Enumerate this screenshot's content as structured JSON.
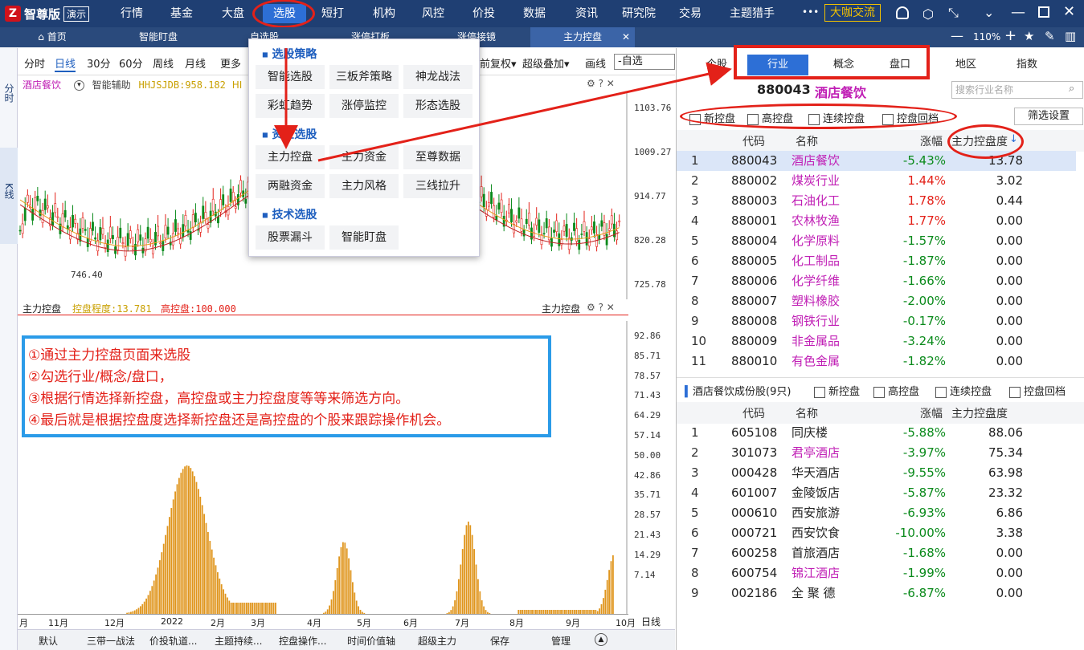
{
  "app": {
    "logo_name": "智尊版",
    "demo": "演示"
  },
  "menu": [
    "行情",
    "基金",
    "大盘",
    "选股",
    "短打",
    "机构",
    "风控",
    "价投",
    "数据",
    "资讯",
    "研究院",
    "交易",
    "主题猎手"
  ],
  "more_label": "•••",
  "exchange_button": "大咖交流",
  "tabs": [
    "首页",
    "智能盯盘",
    "自选股",
    "涨停打板",
    "涨停接镜",
    "主力控盘"
  ],
  "zoom": "110%",
  "left_strip": {
    "top": "分时",
    "bottom": "K线"
  },
  "chart_toolbar": [
    "分时",
    "日线",
    "30分",
    "60分",
    "周线",
    "月线",
    "更多"
  ],
  "chart_toolbar_right": {
    "fuquan": "前复权▾",
    "overlay": "超级叠加▾",
    "draw": "画线",
    "combo": "-自选"
  },
  "kline": {
    "name": "酒店餐饮",
    "assist": "智能辅助",
    "indicator": "HHJSJDB:958.182",
    "indicator_tail": "HI",
    "ticks": [
      "1103.76",
      "1009.27",
      "914.77",
      "820.28",
      "725.78"
    ],
    "low_label": "746.40"
  },
  "lower": {
    "title": "主力控盘",
    "degree": "控盘程度:13.781",
    "high": "高控盘:100.000",
    "right_label": "主力控盘",
    "ticks": [
      "92.86",
      "85.71",
      "78.57",
      "71.43",
      "64.29",
      "57.14",
      "50.00",
      "42.86",
      "35.71",
      "28.57",
      "21.43",
      "14.29",
      "7.14"
    ],
    "xlabels": [
      "月",
      "11月",
      "12月",
      "2022",
      "2月",
      "3月",
      "4月",
      "5月",
      "6月",
      "7月",
      "8月",
      "9月",
      "10月"
    ],
    "period": "日线"
  },
  "dropdown": {
    "sec1": "选股策略",
    "items1": [
      "智能选股",
      "三板斧策略",
      "神龙战法",
      "彩虹趋势",
      "涨停监控",
      "形态选股"
    ],
    "sec2": "资金选股",
    "items2": [
      "主力控盘",
      "主力资金",
      "至尊数据",
      "两融资金",
      "主力风格",
      "三线拉升"
    ],
    "sec3": "技术选股",
    "items3": [
      "股票漏斗",
      "智能盯盘"
    ]
  },
  "annotation": [
    "①通过主力控盘页面来选股",
    "②勾选行业/概念/盘口，",
    "③根据行情选择新控盘，高控盘或主力控盘度等等来筛选方向。",
    "④最后就是根据控盘度选择新控盘还是高控盘的个股来跟踪操作机会。"
  ],
  "bottom_tools": [
    "默认",
    "三带一战法",
    "价投轨道...",
    "主题持续...",
    "控盘操作...",
    "时间价值轴",
    "超级主力",
    "保存",
    "管理"
  ],
  "right": {
    "tabs": [
      "个股",
      "行业",
      "概念",
      "盘口",
      "地区",
      "指数"
    ],
    "code": "880043",
    "name": "酒店餐饮",
    "search_placeholder": "搜索行业名称",
    "filters": [
      "新控盘",
      "高控盘",
      "连续控盘",
      "控盘回档"
    ],
    "filter_btn": "筛选设置",
    "headers": [
      "代码",
      "名称",
      "涨幅",
      "主力控盘度"
    ],
    "rows": [
      [
        "1",
        "880043",
        "酒店餐饮",
        "-5.43%",
        "13.78"
      ],
      [
        "2",
        "880002",
        "煤炭行业",
        "1.44%",
        "3.02"
      ],
      [
        "3",
        "880003",
        "石油化工",
        "1.78%",
        "0.44"
      ],
      [
        "4",
        "880001",
        "农林牧渔",
        "1.77%",
        "0.00"
      ],
      [
        "5",
        "880004",
        "化学原料",
        "-1.57%",
        "0.00"
      ],
      [
        "6",
        "880005",
        "化工制品",
        "-1.87%",
        "0.00"
      ],
      [
        "7",
        "880006",
        "化学纤维",
        "-1.66%",
        "0.00"
      ],
      [
        "8",
        "880007",
        "塑料橡胶",
        "-2.00%",
        "0.00"
      ],
      [
        "9",
        "880008",
        "钢铁行业",
        "-0.17%",
        "0.00"
      ],
      [
        "10",
        "880009",
        "非金属品",
        "-3.24%",
        "0.00"
      ],
      [
        "11",
        "880010",
        "有色金属",
        "-1.82%",
        "0.00"
      ]
    ],
    "sub_title": "酒店餐饮成份股(9只)",
    "sub_rows": [
      [
        "1",
        "605108",
        "同庆楼",
        "-5.88%",
        "88.06"
      ],
      [
        "2",
        "301073",
        "君亭酒店",
        "-3.97%",
        "75.34"
      ],
      [
        "3",
        "000428",
        "华天酒店",
        "-9.55%",
        "63.98"
      ],
      [
        "4",
        "601007",
        "金陵饭店",
        "-5.87%",
        "23.32"
      ],
      [
        "5",
        "000610",
        "西安旅游",
        "-6.93%",
        "6.86"
      ],
      [
        "6",
        "000721",
        "西安饮食",
        "-10.00%",
        "3.38"
      ],
      [
        "7",
        "600258",
        "首旅酒店",
        "-1.68%",
        "0.00"
      ],
      [
        "8",
        "600754",
        "锦江酒店",
        "-1.99%",
        "0.00"
      ],
      [
        "9",
        "002186",
        "全 聚 德",
        "-6.87%",
        "0.00"
      ]
    ]
  }
}
